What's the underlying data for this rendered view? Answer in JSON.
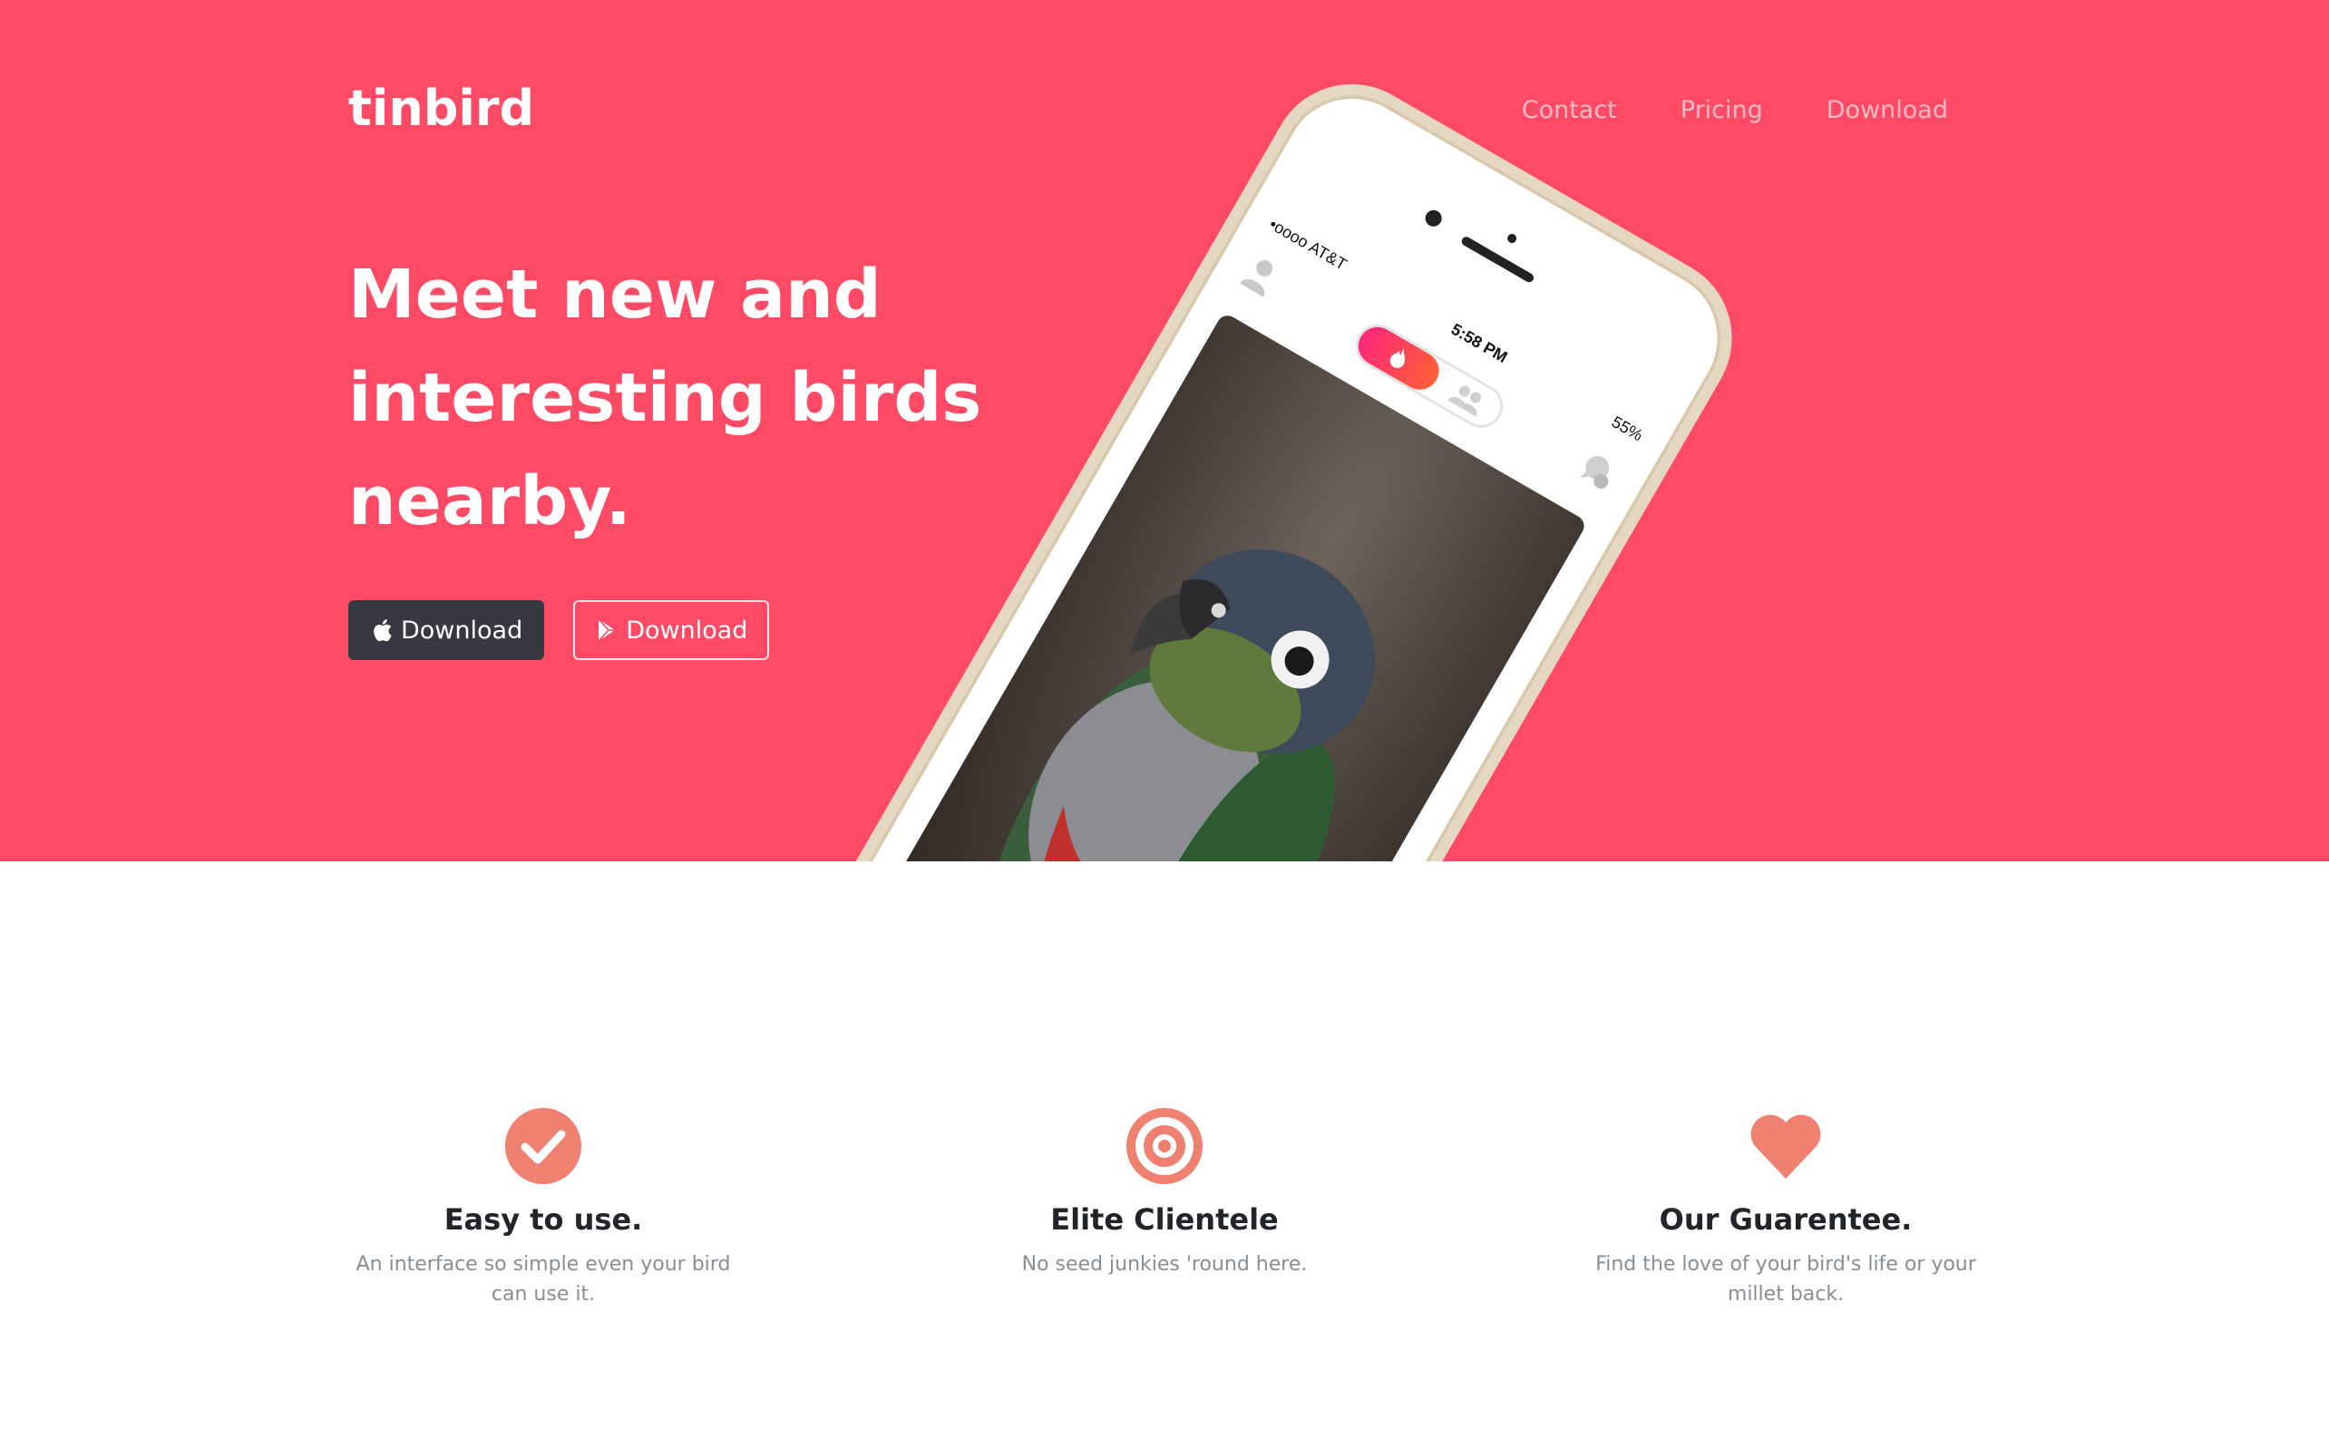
{
  "brand": "tinbird",
  "nav": {
    "contact": "Contact",
    "pricing": "Pricing",
    "download": "Download"
  },
  "hero": {
    "headline": "Meet new and interesting birds nearby.",
    "ios_button": "Download",
    "android_button": "Download",
    "background_color": "#ff4a66"
  },
  "phone": {
    "carrier": "•oooo AT&T",
    "time": "5:58 PM",
    "battery": "55%",
    "icons": [
      "profile-icon",
      "flame-icon",
      "group-icon",
      "chat-icon"
    ]
  },
  "features": [
    {
      "icon": "check-circle-icon",
      "title": "Easy to use.",
      "text": "An interface so simple even your bird can use it."
    },
    {
      "icon": "target-icon",
      "title": "Elite Clientele",
      "text": "No seed junkies 'round here."
    },
    {
      "icon": "heart-icon",
      "title": "Our Guarentee.",
      "text": "Find the love of your bird's life or your millet back."
    }
  ],
  "accent_color": "#f08070"
}
